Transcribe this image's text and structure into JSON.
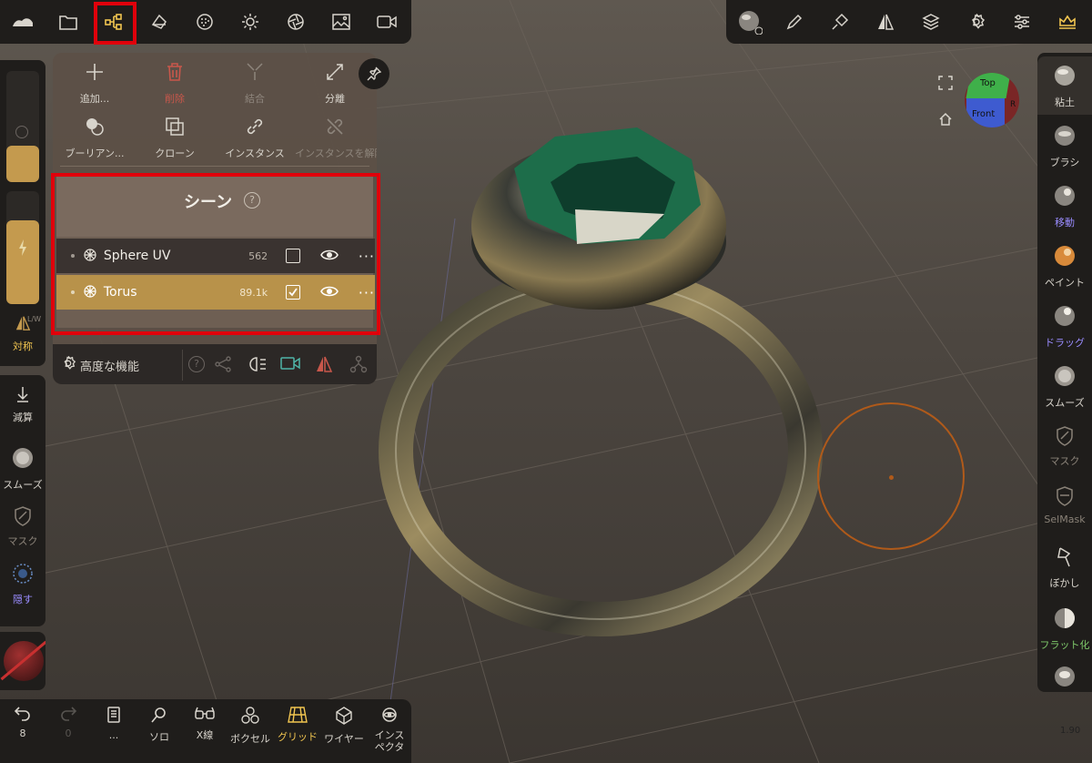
{
  "colors": {
    "accent": "#f1c550",
    "highlight": "#e0000b",
    "selected_row": "#b8924a",
    "purple_label": "#9a8cff",
    "green_label": "#7ec86a",
    "delete_red": "#c8574b"
  },
  "top_toolbar_left": [
    {
      "icon": "cloud-icon",
      "name": "cloud"
    },
    {
      "icon": "folder-icon",
      "name": "files"
    },
    {
      "icon": "scene-tree-icon",
      "name": "scene"
    },
    {
      "icon": "topology-icon",
      "name": "topology"
    },
    {
      "icon": "material-sphere-icon",
      "name": "material"
    },
    {
      "icon": "sun-icon",
      "name": "lighting"
    },
    {
      "icon": "aperture-icon",
      "name": "camera-settings"
    },
    {
      "icon": "image-icon",
      "name": "background"
    },
    {
      "icon": "video-camera-icon",
      "name": "camera"
    }
  ],
  "top_toolbar_right": [
    {
      "icon": "material-ball-icon"
    },
    {
      "icon": "pen-icon"
    },
    {
      "icon": "paint-brush-icon"
    },
    {
      "icon": "symmetry-icon"
    },
    {
      "icon": "layers-icon"
    },
    {
      "icon": "settings-icon"
    },
    {
      "icon": "sliders-icon"
    },
    {
      "icon": "crown-icon"
    }
  ],
  "scene_panel": {
    "actions": [
      {
        "label": "追加...",
        "icon": "plus-icon"
      },
      {
        "label": "削除",
        "icon": "trash-icon"
      },
      {
        "label": "結合",
        "icon": "merge-icon"
      },
      {
        "label": "分離",
        "icon": "split-icon"
      },
      {
        "label": "ブーリアン...",
        "icon": "boolean-icon"
      },
      {
        "label": "クローン",
        "icon": "clone-icon"
      },
      {
        "label": "インスタンス",
        "icon": "link-icon"
      },
      {
        "label": "インスタンスを解除",
        "icon": "unlink-icon"
      }
    ],
    "title": "シーン",
    "help": "?",
    "objects": [
      {
        "name": "Sphere UV",
        "count": "562",
        "checked": false,
        "visible": true
      },
      {
        "name": "Torus",
        "count": "89.1k",
        "checked": true,
        "visible": true
      }
    ],
    "footer_label": "高度な機能"
  },
  "left_tools": [
    {
      "label": "対称",
      "sub": "L/W"
    },
    {
      "label": "減算"
    },
    {
      "label": "スムーズ"
    },
    {
      "label": "マスク"
    },
    {
      "label": "隠す"
    }
  ],
  "right_tools": [
    {
      "label": "粘土"
    },
    {
      "label": "ブラシ"
    },
    {
      "label": "移動"
    },
    {
      "label": "ペイント"
    },
    {
      "label": "ドラッグ"
    },
    {
      "label": "スムーズ"
    },
    {
      "label": "マスク"
    },
    {
      "label": "SelMask"
    },
    {
      "label": "ぼかし"
    },
    {
      "label": "フラット化"
    }
  ],
  "bottom_tools": [
    {
      "label": "8",
      "icon": "undo-icon"
    },
    {
      "label": "0",
      "icon": "redo-icon"
    },
    {
      "label": "...",
      "icon": "book-icon"
    },
    {
      "label": "ソロ",
      "icon": "search-icon"
    },
    {
      "label": "X線",
      "icon": "glasses-icon"
    },
    {
      "label": "ボクセル",
      "icon": "voxel-icon"
    },
    {
      "label": "グリッド",
      "icon": "grid-icon"
    },
    {
      "label": "ワイヤー",
      "icon": "wire-icon"
    },
    {
      "label": "インスペクタ",
      "icon": "eye-icon"
    }
  ],
  "gizmo": {
    "top": "Top",
    "front": "Front",
    "right": "R"
  },
  "version": "1.90"
}
